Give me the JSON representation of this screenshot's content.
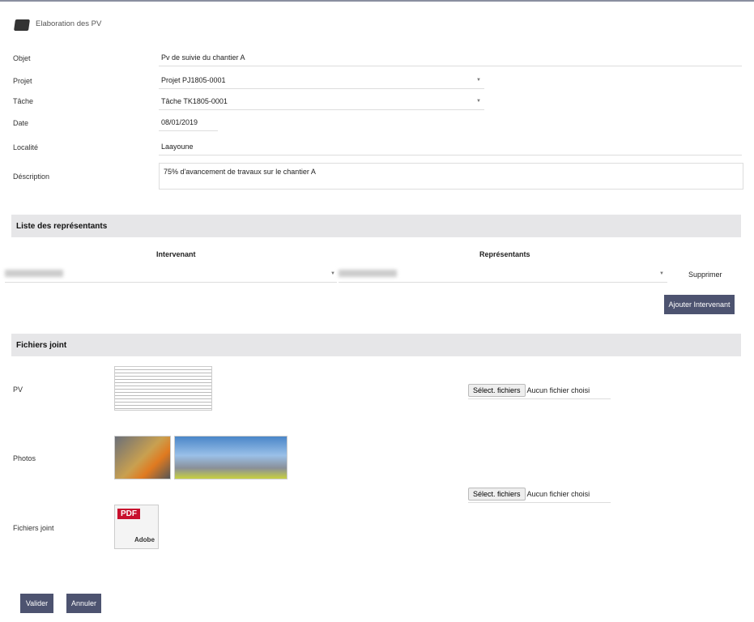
{
  "header": {
    "title": "Elaboration des PV"
  },
  "form": {
    "objet": {
      "label": "Objet",
      "value": "Pv de suivie du chantier A"
    },
    "projet": {
      "label": "Projet",
      "value": "Projet PJ1805-0001"
    },
    "tache": {
      "label": "Tâche",
      "value": "Tâche TK1805-0001"
    },
    "date": {
      "label": "Date",
      "value": "08/01/2019"
    },
    "localite": {
      "label": "Localité",
      "value": "Laayoune"
    },
    "description": {
      "label": "Déscription",
      "value": "75% d'avancement de travaux sur le  chantier A"
    }
  },
  "representants": {
    "title": "Liste des représentants",
    "col_intervenant": "Intervenant",
    "col_representants": "Représentants",
    "delete_label": "Supprimer",
    "add_button": "Ajouter Intervenant"
  },
  "fichiers": {
    "title": "Fichiers joint",
    "pv_label": "PV",
    "photos_label": "Photos",
    "joint_label": "Fichiers joint",
    "select_button": "Sélect. fichiers",
    "no_file": "Aucun fichier choisi",
    "pdf_text": "PDF",
    "adobe_text": "Adobe"
  },
  "actions": {
    "validate": "Valider",
    "cancel": "Annuler"
  }
}
